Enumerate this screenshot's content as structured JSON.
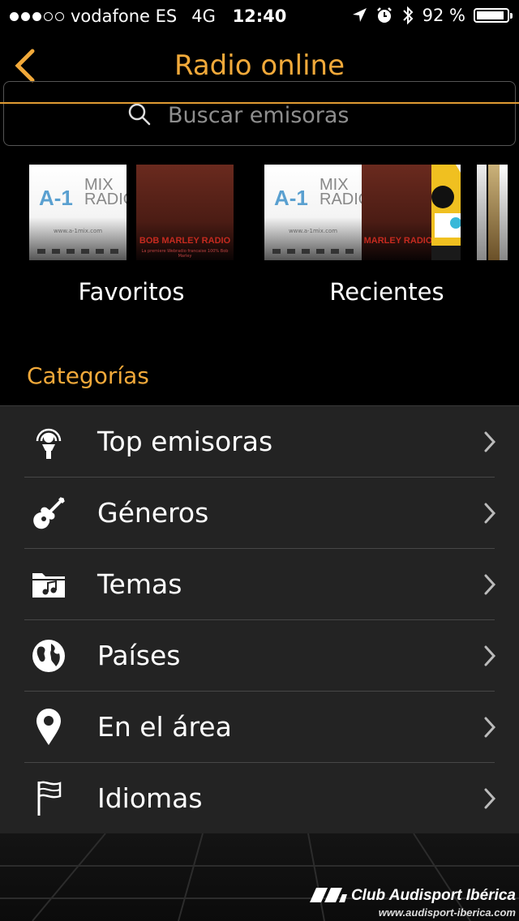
{
  "status": {
    "carrier": "vodafone ES",
    "network": "4G",
    "time": "12:40",
    "battery_text": "92 %",
    "battery_level": 0.92,
    "signal_bars": 3,
    "signal_max": 5
  },
  "nav": {
    "title": "Radio online"
  },
  "search": {
    "placeholder": "Buscar emisoras",
    "value": ""
  },
  "favorites": {
    "label": "Favoritos",
    "covers": [
      {
        "type": "mix",
        "brand": "A-1",
        "brand2a": "MIX",
        "brand2b": "RADIO",
        "url": "www.a-1mix.com"
      },
      {
        "type": "marley",
        "title": "BOB MARLEY RADIO",
        "subtitle": "La premiere Webradio francaise 100% Bob Marley"
      }
    ]
  },
  "recents": {
    "label": "Recientes",
    "covers": [
      {
        "type": "mix",
        "brand": "A-1",
        "brand2a": "MIX",
        "brand2b": "RADIO",
        "url": "www.a-1mix.com"
      },
      {
        "type": "marley",
        "title": "MARLEY RADIO"
      }
    ]
  },
  "categories": {
    "title": "Categorías",
    "items": [
      {
        "label": "Top emisoras",
        "icon": "microphone-icon"
      },
      {
        "label": "Géneros",
        "icon": "guitar-icon"
      },
      {
        "label": "Temas",
        "icon": "music-folder-icon"
      },
      {
        "label": "Países",
        "icon": "globe-icon"
      },
      {
        "label": "En el área",
        "icon": "location-pin-icon"
      },
      {
        "label": "Idiomas",
        "icon": "flag-icon"
      }
    ]
  },
  "watermark": {
    "line1": "Club Audisport Ibérica",
    "line2": "www.audisport-iberica.com"
  },
  "colors": {
    "accent": "#f1a93a",
    "list_bg": "#232323",
    "background": "#000000"
  }
}
